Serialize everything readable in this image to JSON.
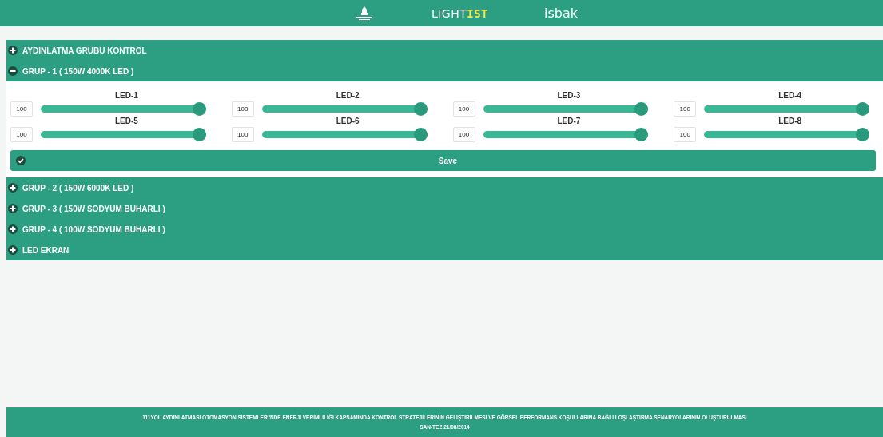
{
  "header": {
    "logo_light": "LIGHT",
    "logo_ist": "IST",
    "logo_isbak": "isbak"
  },
  "sections": [
    {
      "label": "AYDINLATMA GRUBU KONTROL",
      "expanded": false
    },
    {
      "label": "GRUP - 1 ( 150W 4000K LED )",
      "expanded": true,
      "leds": [
        {
          "label": "LED-1",
          "value": "100",
          "level": 1
        },
        {
          "label": "LED-2",
          "value": "100",
          "level": 1
        },
        {
          "label": "LED-3",
          "value": "100",
          "level": 1
        },
        {
          "label": "LED-4",
          "value": "100",
          "level": 1
        },
        {
          "label": "LED-5",
          "value": "100",
          "level": 1
        },
        {
          "label": "LED-6",
          "value": "100",
          "level": 1
        },
        {
          "label": "LED-7",
          "value": "100",
          "level": 1
        },
        {
          "label": "LED-8",
          "value": "100",
          "level": 1
        }
      ],
      "save": "Save"
    },
    {
      "label": "GRUP - 2 ( 150W 6000K LED )",
      "expanded": false
    },
    {
      "label": "GRUP - 3 ( 150W SODYUM BUHARLI )",
      "expanded": false
    },
    {
      "label": "GRUP - 4 ( 100W SODYUM BUHARLI )",
      "expanded": false
    },
    {
      "label": "LED EKRAN",
      "expanded": false
    }
  ],
  "footer": {
    "title": "111YOL AYDINLATMASI OTOMASYON SİSTEMLERİ'NDE ENERJİ VERİMLİLİĞİ KAPSAMINDA KONTROL STRATEJİLERİNİN GELİŞTİRİLMESİ VE GÖRSEL PERFORMANS KOŞULLARINA BAĞLI LOŞLAŞTIRMA SENARYOLARININ OLUŞTURULMASI",
    "subtitle": "SAN-TEZ 21/08/2014"
  }
}
